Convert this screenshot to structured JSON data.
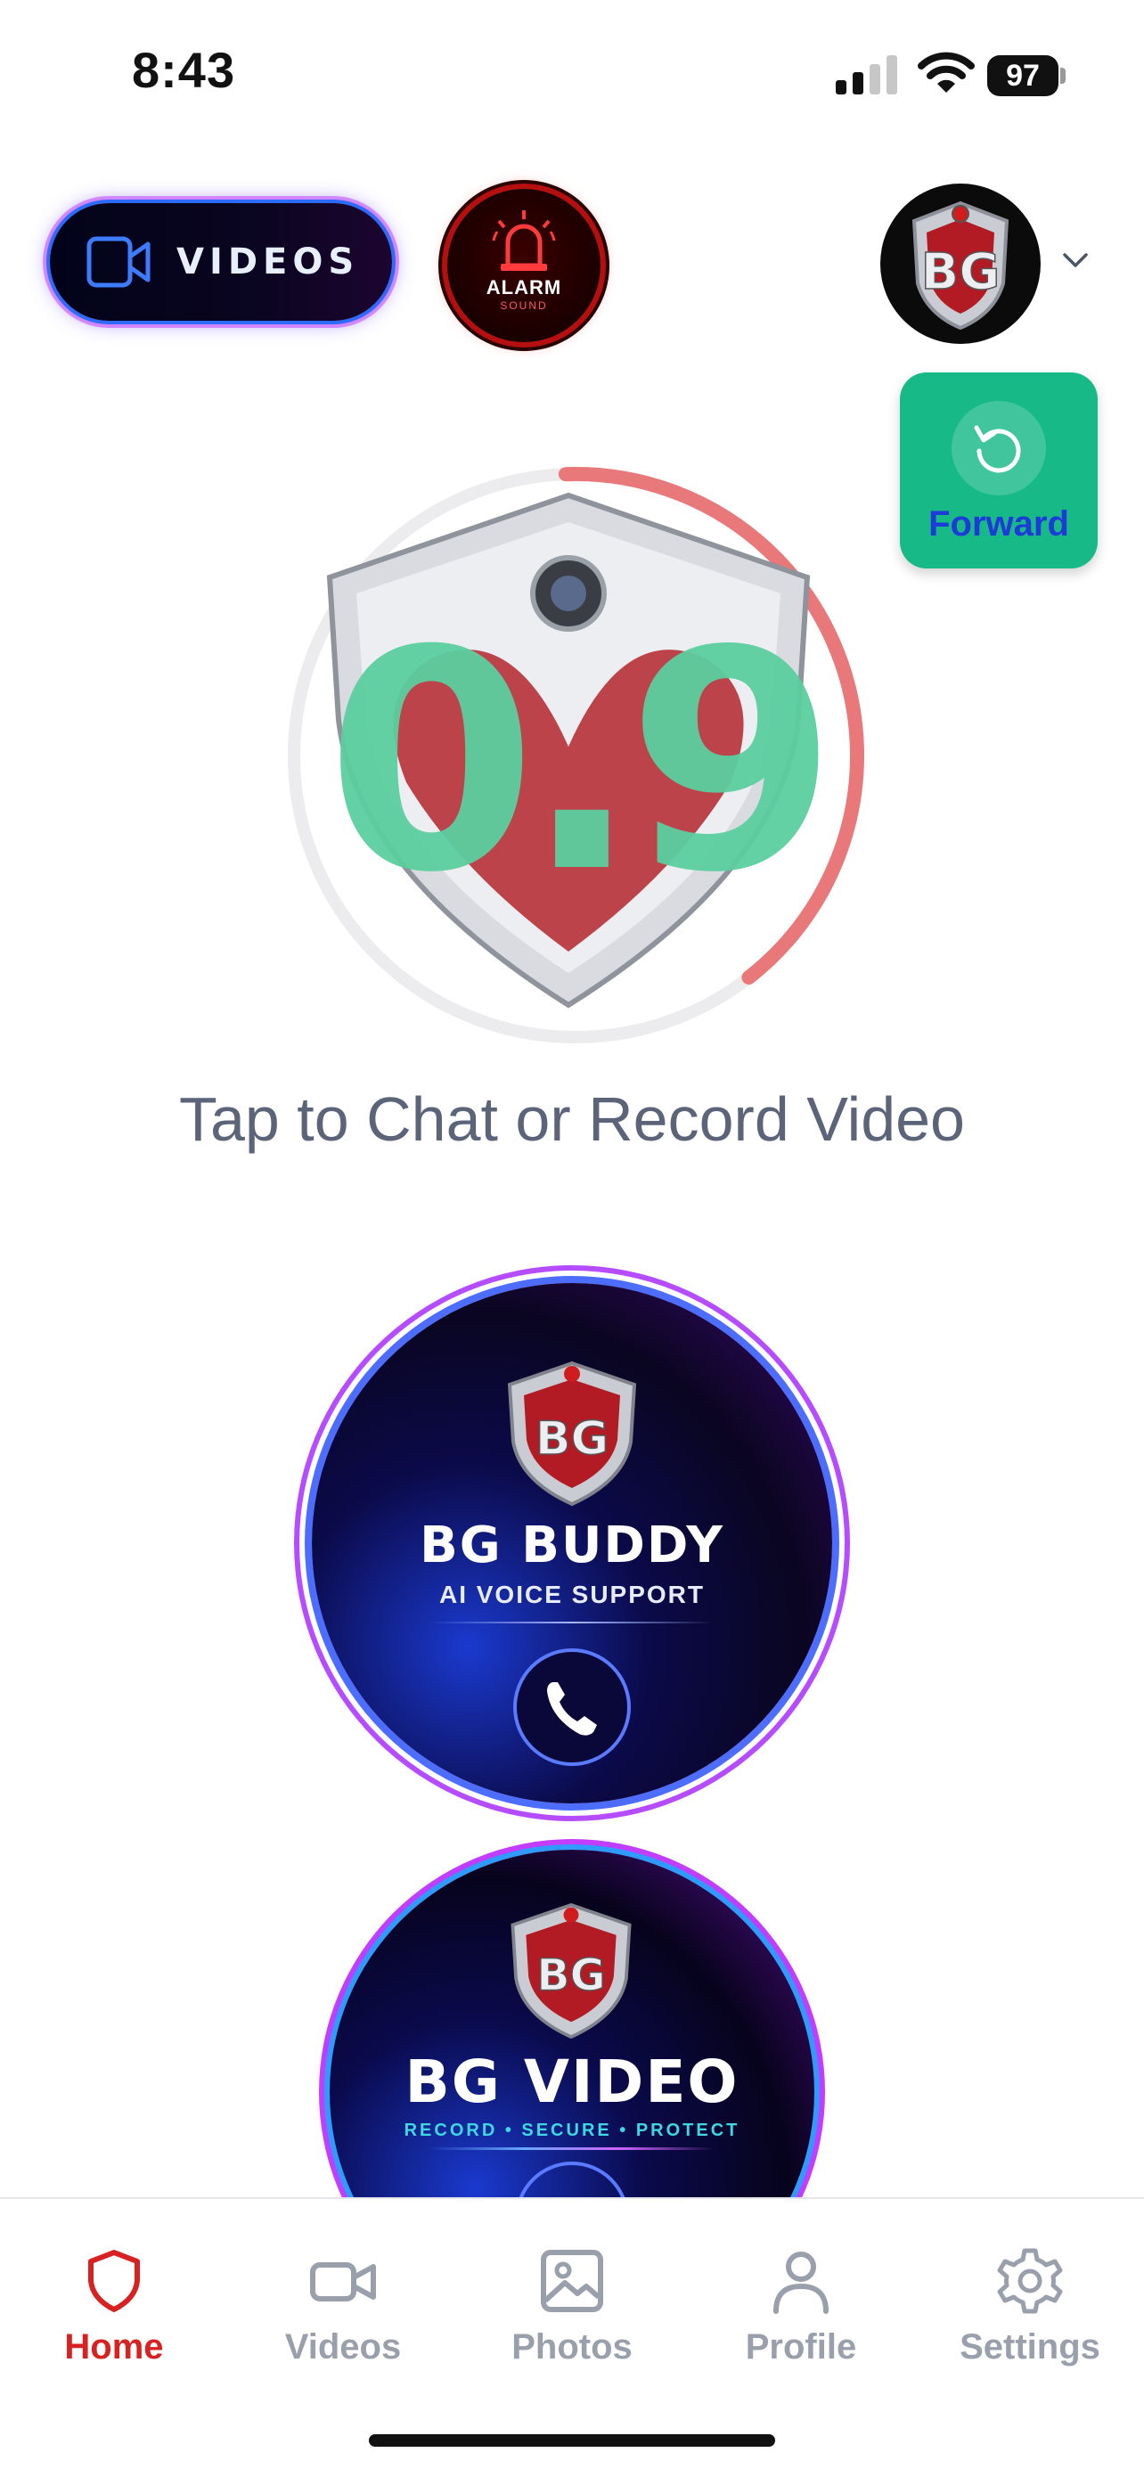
{
  "status_bar": {
    "time": "8:43",
    "battery": "97"
  },
  "header": {
    "videos_button_label": "VIDEOS",
    "alarm_button": {
      "line1": "ALARM",
      "line2": "SOUND"
    },
    "avatar_initials": "BG"
  },
  "forward_button": {
    "label": "Forward",
    "color": "#17b987"
  },
  "record": {
    "countdown": "0.9",
    "progress": 0.4,
    "caption": "Tap to Chat or Record Video"
  },
  "buddy_card": {
    "logo": "BG",
    "title": "BG BUDDY",
    "subtitle": "AI VOICE SUPPORT"
  },
  "video_card": {
    "logo": "BG",
    "title": "BG VIDEO",
    "subtitle": "RECORD • SECURE • PROTECT"
  },
  "tabs": [
    {
      "label": "Home",
      "icon": "shield-icon",
      "active": true
    },
    {
      "label": "Videos",
      "icon": "video-camera-icon",
      "active": false
    },
    {
      "label": "Photos",
      "icon": "image-icon",
      "active": false
    },
    {
      "label": "Profile",
      "icon": "person-icon",
      "active": false
    },
    {
      "label": "Settings",
      "icon": "gear-icon",
      "active": false
    }
  ],
  "colors": {
    "accent_active": "#d82222",
    "countdown": "#5ccfa0",
    "progress_ring": "#e8787a"
  }
}
